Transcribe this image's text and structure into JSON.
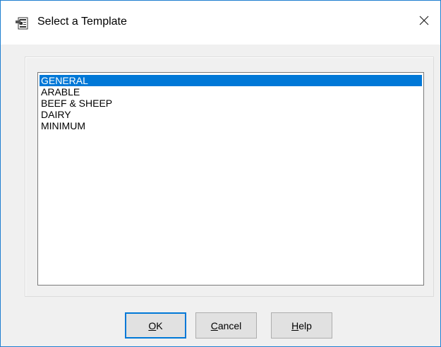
{
  "window": {
    "title": "Select a Template",
    "icon": "template-icon",
    "close_icon": "close-icon"
  },
  "templates": {
    "items": [
      "GENERAL",
      "ARABLE",
      "BEEF & SHEEP",
      "DAIRY",
      "MINIMUM"
    ],
    "selected_index": 0
  },
  "buttons": {
    "ok": {
      "mnemonic": "O",
      "rest": "K"
    },
    "cancel": {
      "mnemonic": "C",
      "rest": "ancel"
    },
    "help": {
      "mnemonic": "H",
      "rest": "elp"
    }
  },
  "colors": {
    "selection": "#0078d7",
    "window_border": "#1f7fd0"
  }
}
